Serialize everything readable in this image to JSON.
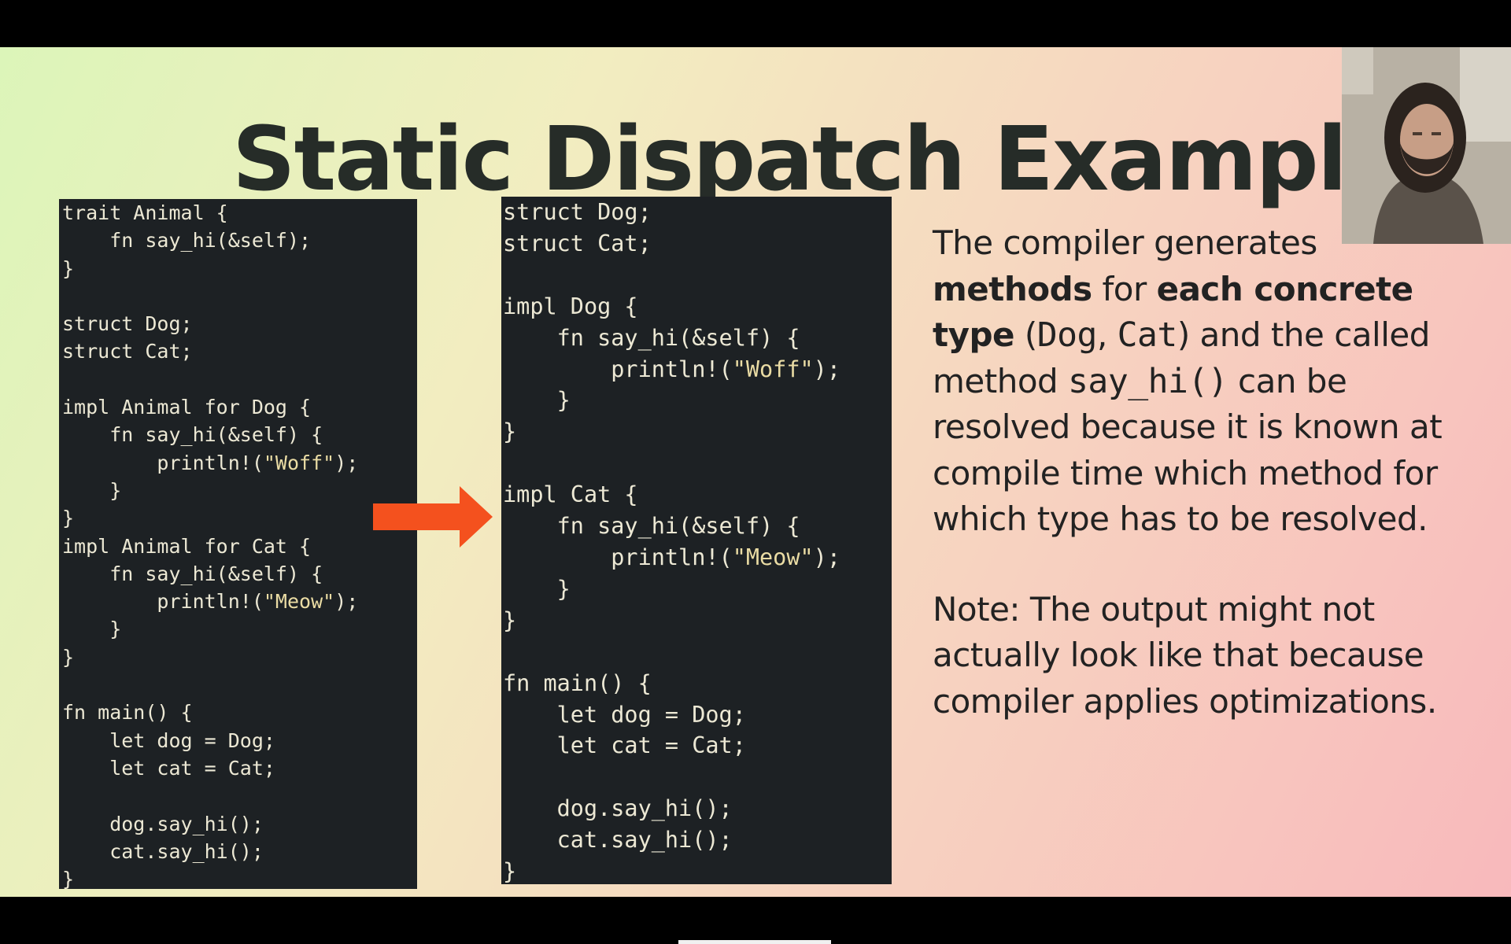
{
  "slide": {
    "title": "Static Dispatch Example"
  },
  "code_left": {
    "lines": [
      "trait Animal {",
      "    fn say_hi(&self);",
      "}",
      "",
      "struct Dog;",
      "struct Cat;",
      "",
      "impl Animal for Dog {",
      "    fn say_hi(&self) {",
      "        println!(\"Woff\");",
      "    }",
      "}",
      "impl Animal for Cat {",
      "    fn say_hi(&self) {",
      "        println!(\"Meow\");",
      "    }",
      "}",
      "",
      "fn main() {",
      "    let dog = Dog;",
      "    let cat = Cat;",
      "",
      "    dog.say_hi();",
      "    cat.say_hi();",
      "}"
    ]
  },
  "code_right": {
    "lines": [
      "struct Dog;",
      "struct Cat;",
      "",
      "impl Dog {",
      "    fn say_hi(&self) {",
      "        println!(\"Woff\");",
      "    }",
      "}",
      "",
      "impl Cat {",
      "    fn say_hi(&self) {",
      "        println!(\"Meow\");",
      "    }",
      "}",
      "",
      "fn main() {",
      "    let dog = Dog;",
      "    let cat = Cat;",
      "",
      "    dog.say_hi();",
      "    cat.say_hi();",
      "}"
    ]
  },
  "explanation": {
    "p1_a": "The compiler generates",
    "p1_b_bold": "methods",
    "p1_c": " for ",
    "p1_d_bold": "each concrete type",
    "p1_e": " (",
    "p1_f_mono": "Dog",
    "p1_g": ", ",
    "p1_h_mono": "Cat",
    "p1_i": ") and the called method ",
    "p1_j_mono": "say_hi()",
    "p1_k": " can be resolved because it is known at compile time which method for which type has to be resolved.",
    "note": "Note: The output might not actually look like that because compiler applies optimizations."
  },
  "colors": {
    "code_bg": "#1d2124",
    "arrow": "#f4511e",
    "title": "#262c28"
  },
  "icons": {
    "arrow": "right-arrow-icon"
  }
}
